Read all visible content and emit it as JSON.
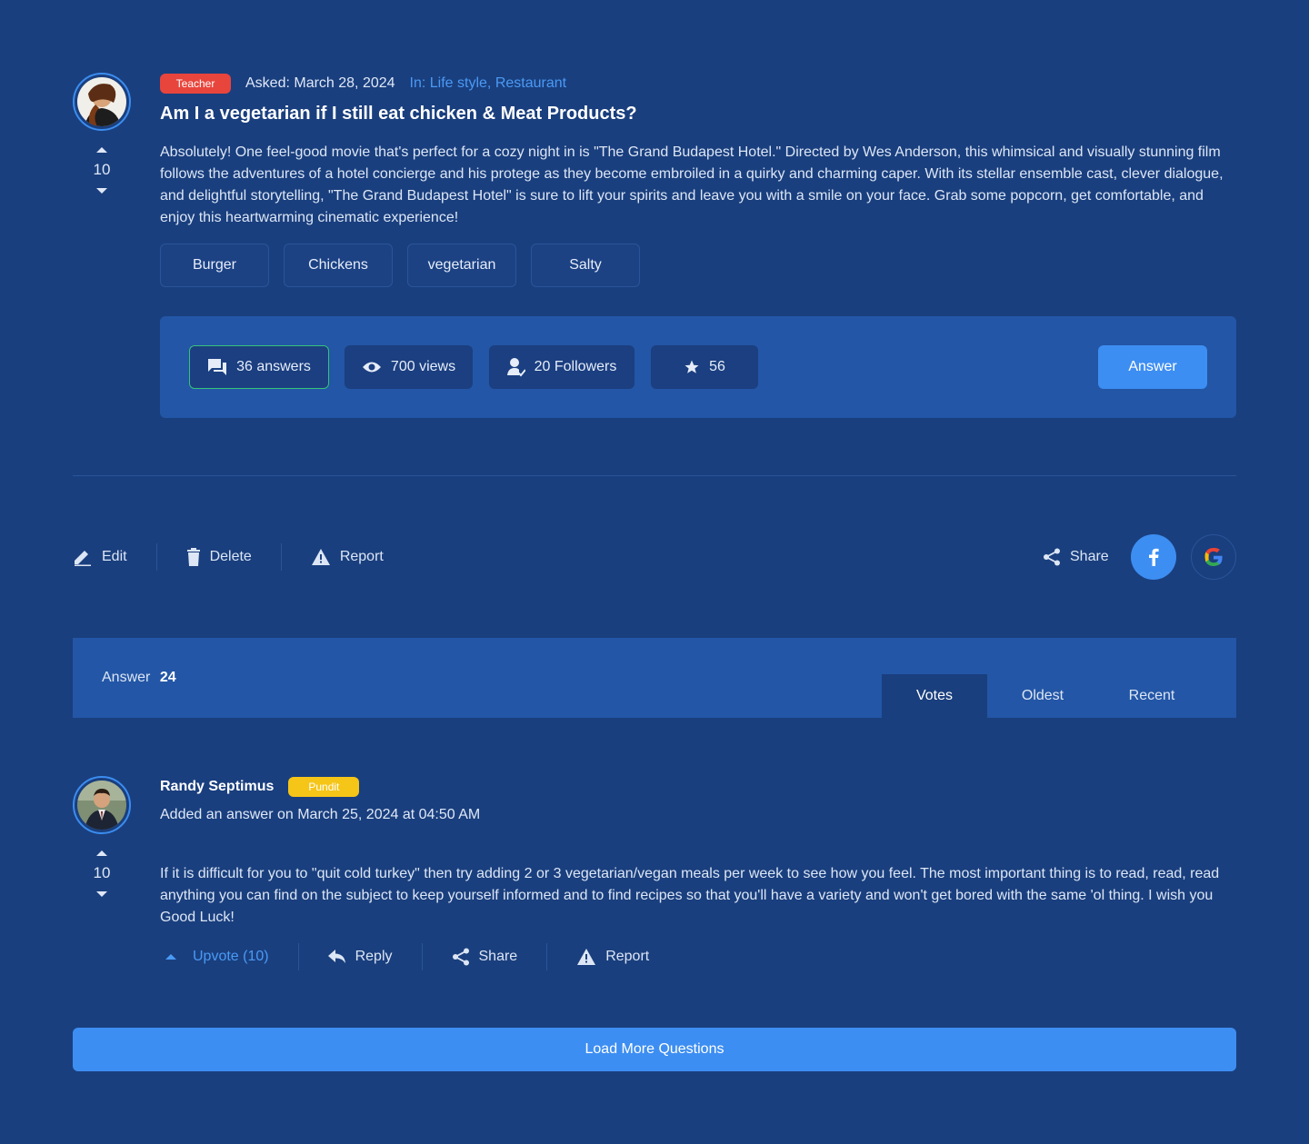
{
  "question": {
    "badge": "Teacher",
    "asked": "Asked: March 28, 2024",
    "in": "In: Life style, Restaurant",
    "title": "Am I a vegetarian if I still eat chicken & Meat Products?",
    "votes": "10",
    "body": "Absolutely! One feel-good movie that's perfect for a cozy night in is \"The Grand Budapest Hotel.\" Directed by Wes Anderson, this whimsical and visually stunning film follows the adventures of a hotel concierge and his protege as they become embroiled in a quirky and charming caper. With its stellar ensemble cast, clever dialogue, and delightful storytelling, \"The Grand Budapest Hotel\" is sure to lift your spirits and leave you with a smile on your face. Grab some popcorn, get comfortable, and enjoy this heartwarming cinematic experience!",
    "tags": [
      "Burger",
      "Chickens",
      "vegetarian",
      "Salty"
    ],
    "stats": {
      "answers": "36 answers",
      "views": "700 views",
      "followers": "20 Followers",
      "stars": "56"
    },
    "answer_button": "Answer"
  },
  "actions": {
    "edit": "Edit",
    "delete": "Delete",
    "report": "Report",
    "share": "Share"
  },
  "answers_header": {
    "label": "Answer",
    "count": "24",
    "tabs": [
      "Votes",
      "Oldest",
      "Recent"
    ],
    "active_tab": "Votes"
  },
  "answer": {
    "author": "Randy Septimus",
    "badge": "Pundit",
    "added": "Added an answer on March 25, 2024 at 04:50 AM",
    "votes": "10",
    "body": "If it is difficult for you to \"quit cold turkey\" then try adding 2 or 3 vegetarian/vegan meals per week to see how you feel. The most important thing is to read, read, read anything you can find on the subject to keep yourself informed and to find recipes so that you'll have a variety and won't get bored with the same 'ol thing. I wish you Good Luck!",
    "actions": {
      "upvote": "Upvote (10)",
      "reply": "Reply",
      "share": "Share",
      "report": "Report"
    }
  },
  "load_more": "Load More Questions",
  "colors": {
    "background": "#1a3f7e",
    "panel": "#2356a6",
    "accent": "#3d8ef2",
    "teacher_badge": "#e8453c",
    "pundit_badge": "#f5c518",
    "active_border": "#35c27a"
  },
  "icons": [
    "chevron-up-icon",
    "chevron-down-icon",
    "chat-icon",
    "eye-icon",
    "user-check-icon",
    "star-icon",
    "edit-icon",
    "trash-icon",
    "warning-icon",
    "share-icon",
    "facebook-icon",
    "google-icon",
    "reply-icon"
  ]
}
